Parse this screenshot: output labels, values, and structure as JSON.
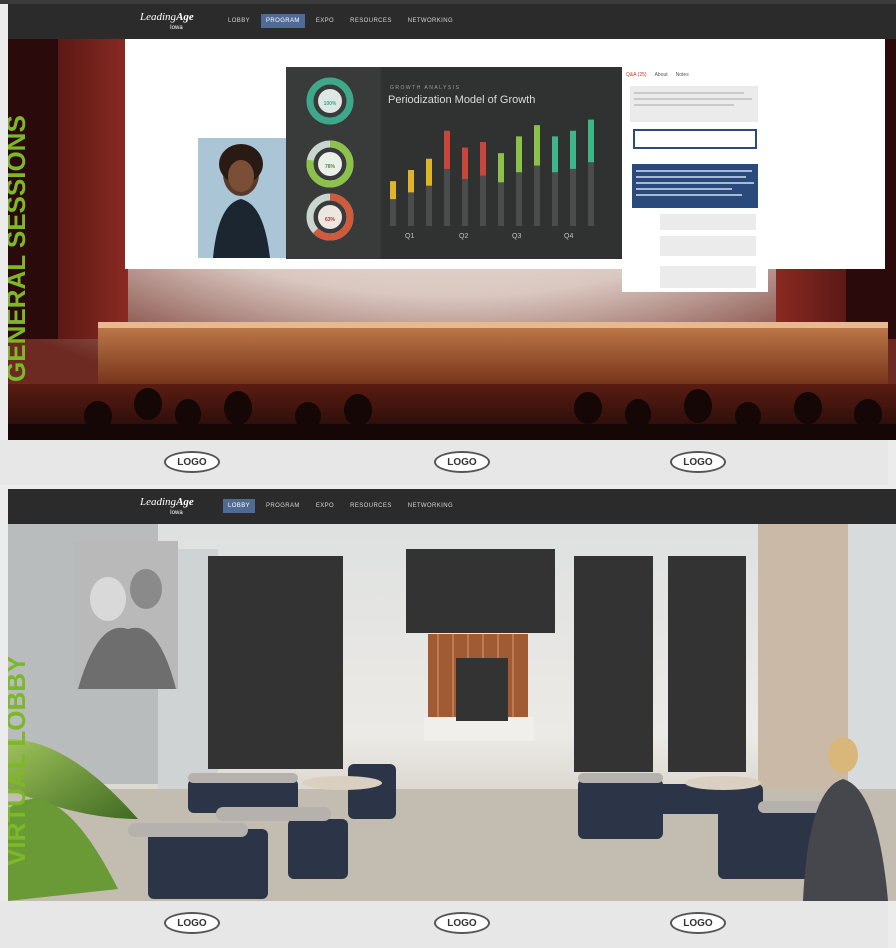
{
  "brand": {
    "name_prefix": "Leading",
    "name_suffix": "Age",
    "region": "Iowa"
  },
  "nav_items": [
    "LOBBY",
    "PROGRAM",
    "EXPO",
    "RESOURCES",
    "NETWORKING"
  ],
  "top_panel": {
    "title": "GENERAL SESSIONS",
    "active_nav": "PROGRAM",
    "slide": {
      "kicker": "GROWTH ANALYSIS",
      "title": "Periodization Model of Growth",
      "donuts": [
        "100%",
        "78%",
        "63%"
      ],
      "chart_data": {
        "type": "bar",
        "categories": [
          "Q1",
          "Q2",
          "Q3",
          "Q4"
        ],
        "series": [
          {
            "values": [
              40,
              50,
              60,
              85,
              70,
              75,
              65,
              80,
              90,
              80,
              85,
              95
            ]
          }
        ]
      }
    },
    "chat": {
      "tabs": [
        "Q&A (25)",
        "About",
        "Notes"
      ]
    }
  },
  "bottom_panel": {
    "title": "VIRTUAL LOBBY",
    "active_nav": "LOBBY"
  },
  "sponsors": {
    "logo_label": "LOGO"
  },
  "colors": {
    "accent_green": "#7db827",
    "nav_active": "#4f6a96",
    "nav_bg": "#2b2b2b"
  }
}
